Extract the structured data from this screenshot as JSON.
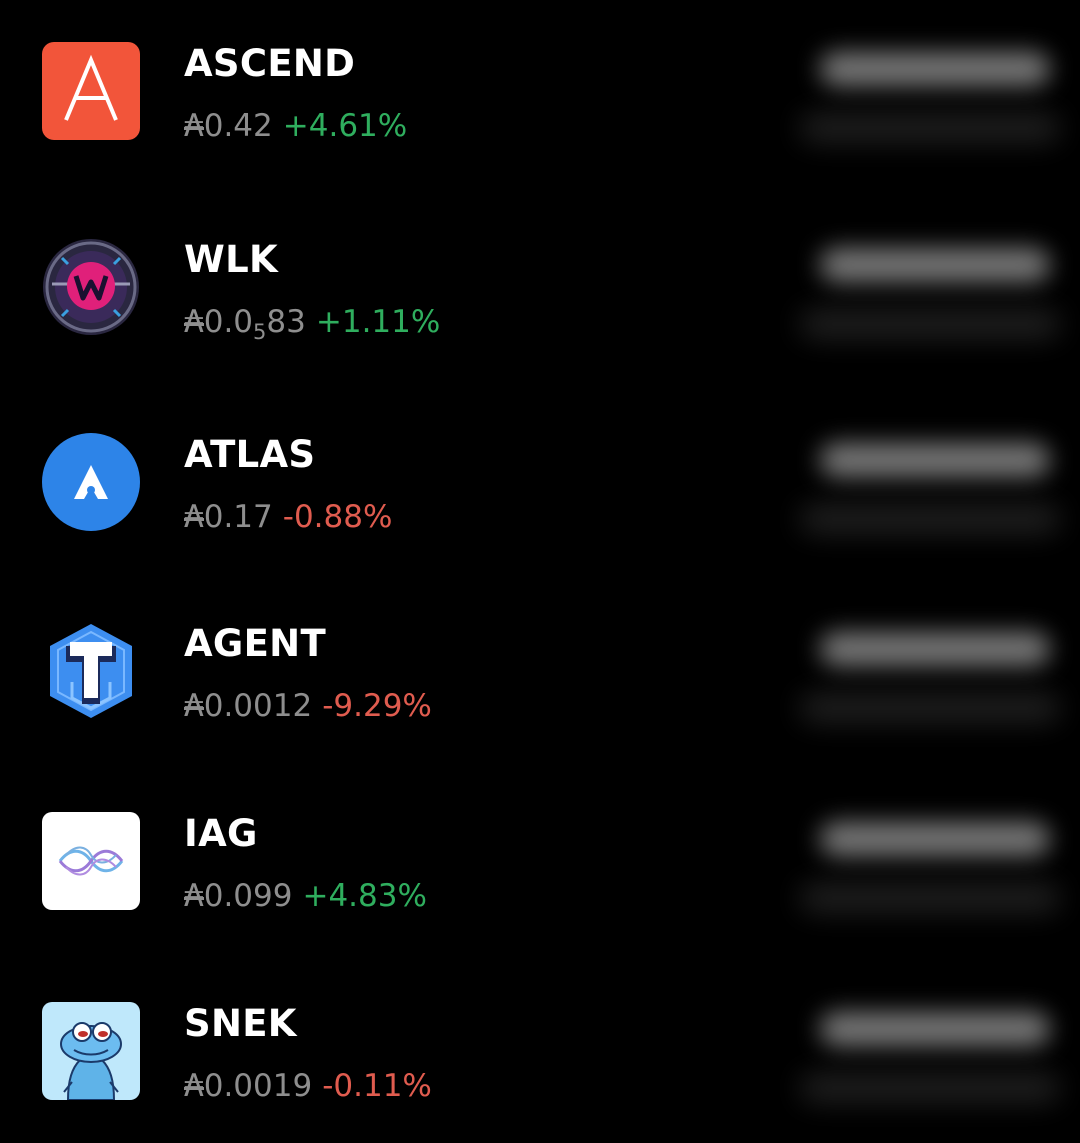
{
  "tokens": [
    {
      "name": "ASCEND",
      "currency_symbol": "₳",
      "price": "0.42",
      "change": "+4.61%",
      "logo": "ascend-logo"
    },
    {
      "name": "WLK",
      "currency_symbol": "₳",
      "price_prefix": "0.0",
      "price_zero_count": "5",
      "price_digits": "83",
      "change": "+1.11%",
      "logo": "wlk-logo"
    },
    {
      "name": "ATLAS",
      "currency_symbol": "₳",
      "price": "0.17",
      "change": "-0.88%",
      "logo": "atlas-logo"
    },
    {
      "name": "AGENT",
      "currency_symbol": "₳",
      "price": "0.0012",
      "change": "-9.29%",
      "logo": "agent-logo"
    },
    {
      "name": "IAG",
      "currency_symbol": "₳",
      "price": "0.099",
      "change": "+4.83%",
      "logo": "iag-logo"
    },
    {
      "name": "SNEK",
      "currency_symbol": "₳",
      "price": "0.0019",
      "change": "-0.11%",
      "logo": "snek-logo"
    }
  ],
  "colors": {
    "background": "#000000",
    "positive": "#2fae5e",
    "negative": "#e05c4f",
    "muted": "#8e8e8e",
    "ascend": "#f2553a",
    "wlk": "#e0207a",
    "atlas": "#2d84e8",
    "agent": "#3d8ef0",
    "snek": "#bfe8fb"
  }
}
